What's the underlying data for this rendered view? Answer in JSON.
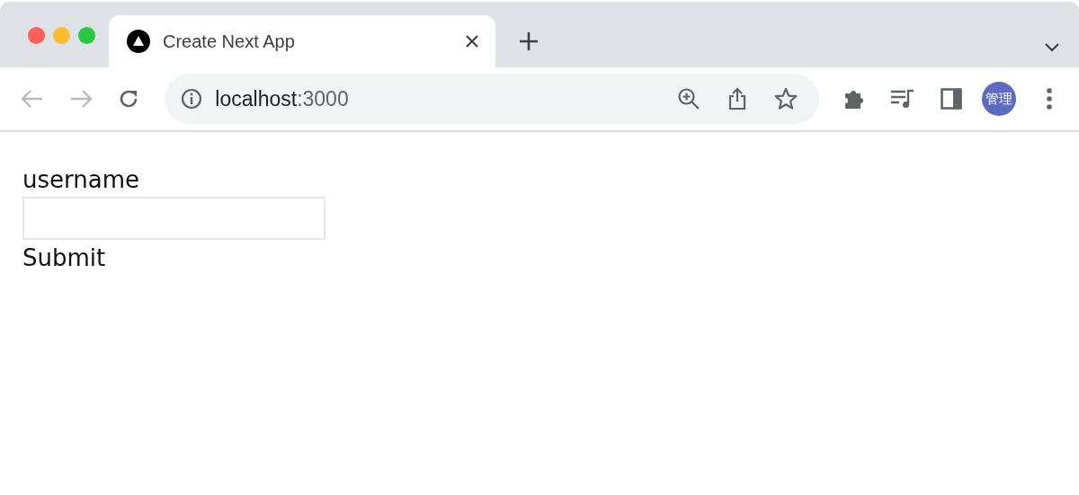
{
  "window": {
    "controls": [
      {
        "color": "#fe5f57"
      },
      {
        "color": "#febc2e"
      },
      {
        "color": "#28c840"
      }
    ]
  },
  "tabs": [
    {
      "title": "Create Next App",
      "selected": true
    }
  ],
  "toolbar": {
    "back_disabled": true,
    "forward_disabled": true,
    "url_host": "localhost",
    "url_port": ":3000",
    "profile": "管理"
  },
  "form": {
    "label": "username",
    "submit": "Submit"
  }
}
